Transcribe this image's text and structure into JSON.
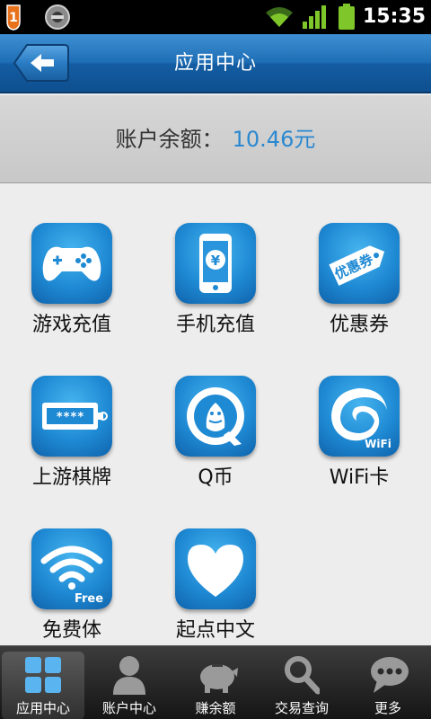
{
  "status_bar": {
    "notification_count": "1",
    "time": "15:35",
    "icons": [
      "notification-badge-icon",
      "circle-app-icon",
      "wifi-icon",
      "signal-icon",
      "battery-icon"
    ]
  },
  "header": {
    "title": "应用中心",
    "back_icon": "back-arrow-icon"
  },
  "balance": {
    "label": "账户余额：",
    "value": "10.46元"
  },
  "apps": [
    {
      "label": "游戏充值",
      "icon": "gamepad-icon"
    },
    {
      "label": "手机充值",
      "icon": "phone-yen-icon"
    },
    {
      "label": "优惠券",
      "icon": "coupon-tag-icon"
    },
    {
      "label": "上游棋牌",
      "icon": "card-password-icon"
    },
    {
      "label": "Q币",
      "icon": "qq-penguin-icon"
    },
    {
      "label": "WiFi卡",
      "icon": "wifi-swirl-icon"
    },
    {
      "label": "免费体",
      "icon": "wifi-free-icon"
    },
    {
      "label": "起点中文",
      "icon": "heart-icon"
    }
  ],
  "icon_text": {
    "coupon": "优惠券",
    "card": "****",
    "wifi_logo": "WiFi",
    "free": "Free",
    "yen": "¥"
  },
  "tabs": [
    {
      "label": "应用中心",
      "icon": "grid-icon",
      "active": true
    },
    {
      "label": "账户中心",
      "icon": "person-icon",
      "active": false
    },
    {
      "label": "赚余额",
      "icon": "piggy-bank-icon",
      "active": false
    },
    {
      "label": "交易查询",
      "icon": "magnifier-icon",
      "active": false
    },
    {
      "label": "更多",
      "icon": "chat-dots-icon",
      "active": false
    }
  ],
  "colors": {
    "header_blue": "#1f6fb6",
    "balance_value": "#2a88d0",
    "icon_blue": "#1f8ad4"
  }
}
